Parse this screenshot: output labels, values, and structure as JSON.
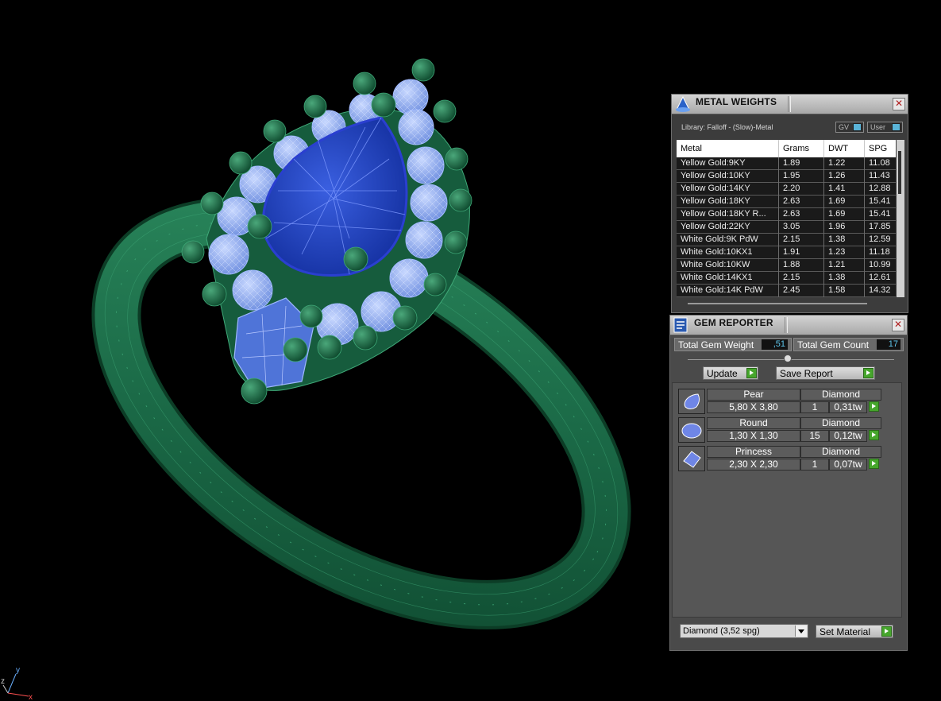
{
  "metal_weights": {
    "title": "METAL WEIGHTS",
    "library_label": "Library: Falloff - (Slow)-Metal",
    "gv_toggle": "GV",
    "user_toggle": "User",
    "columns": [
      "Metal",
      "Grams",
      "DWT",
      "SPG"
    ],
    "rows": [
      {
        "metal": "Yellow Gold:9KY",
        "grams": "1.89",
        "dwt": "1.22",
        "spg": "11.08"
      },
      {
        "metal": "Yellow Gold:10KY",
        "grams": "1.95",
        "dwt": "1.26",
        "spg": "11.43"
      },
      {
        "metal": "Yellow Gold:14KY",
        "grams": "2.20",
        "dwt": "1.41",
        "spg": "12.88"
      },
      {
        "metal": "Yellow Gold:18KY",
        "grams": "2.63",
        "dwt": "1.69",
        "spg": "15.41"
      },
      {
        "metal": "Yellow Gold:18KY R...",
        "grams": "2.63",
        "dwt": "1.69",
        "spg": "15.41"
      },
      {
        "metal": "Yellow Gold:22KY",
        "grams": "3.05",
        "dwt": "1.96",
        "spg": "17.85"
      },
      {
        "metal": "White Gold:9K PdW",
        "grams": "2.15",
        "dwt": "1.38",
        "spg": "12.59"
      },
      {
        "metal": "White Gold:10KX1",
        "grams": "1.91",
        "dwt": "1.23",
        "spg": "11.18"
      },
      {
        "metal": "White Gold:10KW",
        "grams": "1.88",
        "dwt": "1.21",
        "spg": "10.99"
      },
      {
        "metal": "White Gold:14KX1",
        "grams": "2.15",
        "dwt": "1.38",
        "spg": "12.61"
      },
      {
        "metal": "White Gold:14K PdW",
        "grams": "2.45",
        "dwt": "1.58",
        "spg": "14.32"
      }
    ]
  },
  "gem_reporter": {
    "title": "GEM REPORTER",
    "total_weight_label": "Total Gem Weight",
    "total_weight_value": ",51",
    "total_count_label": "Total Gem Count",
    "total_count_value": "17",
    "update_label": "Update",
    "save_report_label": "Save Report",
    "gems": [
      {
        "shape": "Pear",
        "material": "Diamond",
        "size": "5,80 X 3,80",
        "count": "1",
        "weight": "0,31tw"
      },
      {
        "shape": "Round",
        "material": "Diamond",
        "size": "1,30 X 1,30",
        "count": "15",
        "weight": "0,12tw"
      },
      {
        "shape": "Princess",
        "material": "Diamond",
        "size": "2,30 X 2,30",
        "count": "1",
        "weight": "0,07tw"
      }
    ],
    "material_select": "Diamond    (3,52 spg)",
    "set_material_label": "Set Material"
  },
  "axis": {
    "x": "x",
    "y": "y",
    "z": "z"
  },
  "colors": {
    "ring": "#1d6a4a",
    "gem": "#2a4cc0",
    "accent": "#5fc7ee",
    "go_button": "#46a62c"
  }
}
